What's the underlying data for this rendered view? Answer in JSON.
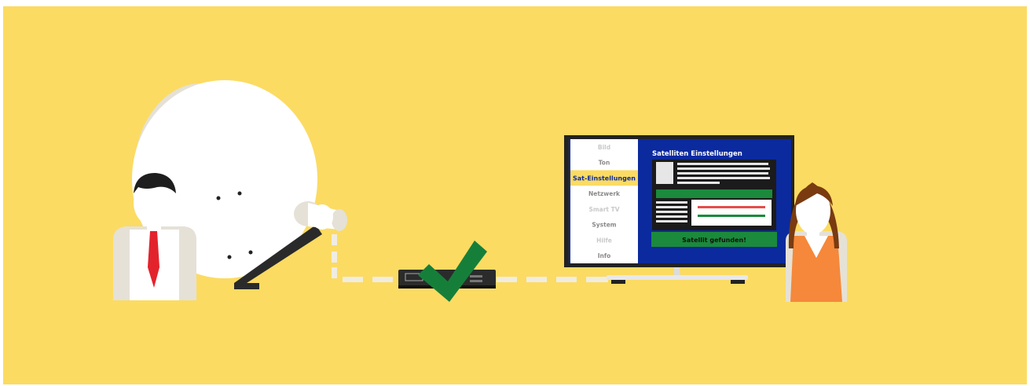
{
  "colors": {
    "background": "#fbdb62",
    "tv_screen": "#0b2a9e",
    "menu_bg": "#ffffff",
    "menu_selected_bg": "#fbdb62",
    "menu_active_text": "#8a8a8a",
    "menu_inactive_text": "#c9c9c9",
    "menu_selected_text": "#0b2a9e",
    "status_green": "#1b8a3c",
    "checkmark_green": "#157f3a",
    "signal_line_red": "#e84b4b",
    "woman_top": "#f5883a",
    "man_tie": "#e3232c"
  },
  "tv": {
    "menu_items": [
      {
        "label": "Bild",
        "state": "inactive"
      },
      {
        "label": "Ton",
        "state": "active"
      },
      {
        "label": "Sat-Einstellungen",
        "state": "selected"
      },
      {
        "label": "Netzwerk",
        "state": "active"
      },
      {
        "label": "Smart TV",
        "state": "inactive"
      },
      {
        "label": "System",
        "state": "active"
      },
      {
        "label": "Hilfe",
        "state": "inactive"
      },
      {
        "label": "Info",
        "state": "active"
      }
    ],
    "panel_title": "Satelliten Einstellungen",
    "status_text": "Satellit gefunden!"
  },
  "icons": {
    "dish": "satellite-dish-icon",
    "man": "man-icon",
    "receiver": "receiver-box-icon",
    "check": "checkmark-icon",
    "woman": "woman-icon"
  }
}
